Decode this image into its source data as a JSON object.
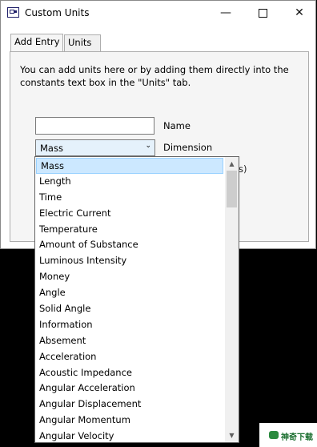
{
  "window": {
    "title": "Custom Units"
  },
  "tabs": [
    {
      "label": "Add Entry"
    },
    {
      "label": "Units"
    }
  ],
  "panel": {
    "description": "You can add units here or by adding them directly into the constants text box in the \"Units\" tab.",
    "name_label": "Name",
    "name_value": "",
    "dimension_label": "Dimension",
    "dimension_selected": "Mass",
    "partial_label_visible": "s)"
  },
  "dropdown": {
    "items": [
      "Mass",
      "Length",
      "Time",
      "Electric Current",
      "Temperature",
      "Amount of Substance",
      "Luminous Intensity",
      "Money",
      "Angle",
      "Solid Angle",
      "Information",
      "Absement",
      "Acceleration",
      "Acoustic Impedance",
      "Angular Acceleration",
      "Angular Displacement",
      "Angular Momentum",
      "Angular Velocity"
    ],
    "selected_index": 0
  },
  "watermark": {
    "text": "神奇下载"
  }
}
